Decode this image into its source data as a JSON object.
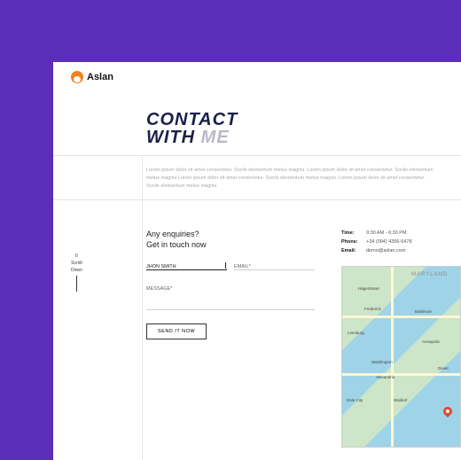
{
  "brand": {
    "name": "Aslan"
  },
  "title": {
    "line1": "CONTACT",
    "line2a": "WITH ",
    "line2b": "ME"
  },
  "intro": "Lorem ipsum dolor sit amet consectetur. Socils elementum metus magnis. Lorem ipsum dolor sit amet consectetur. Socils elementum metus magnis Lorem ipsum dolor sit amet consectetur. Socils elementum metus magnis. Lorem ipsum dolor sit amet consectetur. Socils elementum metus magnis.",
  "scroll": {
    "count": "0",
    "line1": "Scroll",
    "line2": "Down"
  },
  "enq": {
    "line1": "Any enquiries?",
    "line2": "Get in touch now"
  },
  "form": {
    "name_value": "JHON SMITH",
    "email_label": "EMAIL*",
    "message_label": "MESSAGE*",
    "send_label": "SEND IT NOW"
  },
  "contact": {
    "time_k": "Time:",
    "time_v": "9:30 AM - 6:30 PM",
    "phone_k": "Phone:",
    "phone_v": "+34 (094) 4356-5478",
    "email_k": "Email:",
    "email_v": "demo@aslan.com"
  },
  "map": {
    "region": "MARYLAND",
    "cities": {
      "hagerstown": "Hagerstown",
      "frederick": "Frederick",
      "baltimore": "Baltimore",
      "leesburg": "Leesburg",
      "annapolis": "Annapolis",
      "washington": "Washington",
      "alexandria": "Alexandria",
      "dale": "Dale City",
      "waldorf": "Waldorf",
      "dover": "Dover"
    }
  }
}
